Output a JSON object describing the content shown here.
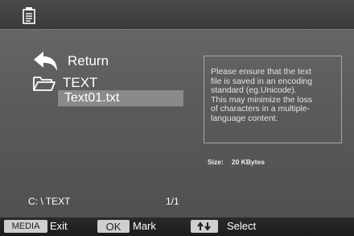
{
  "browser": {
    "return_label": "Return",
    "folder_label": "TEXT",
    "file_label": "Text01.txt"
  },
  "info": {
    "lines": [
      "Please ensure that the text",
      "file is saved in an encoding",
      "standard (eg.Unicode).",
      "This may minimize the loss",
      "of characters in a multiple-",
      "language content."
    ],
    "size_label": "Size:",
    "size_value": "20 KBytes"
  },
  "status": {
    "path": "C: \\ TEXT",
    "page": "1/1"
  },
  "bottom_bar": {
    "media_key": "MEDIA",
    "media_label": "Exit",
    "ok_key": "OK",
    "ok_label": "Mark",
    "arrows_label": "Select"
  },
  "icons": {
    "top": "document-icon",
    "return": "return-arrow-icon",
    "folder": "folder-icon",
    "arrows": "up-down-arrows-icon"
  }
}
